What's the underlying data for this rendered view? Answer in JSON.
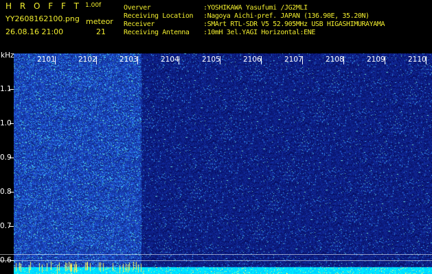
{
  "header": {
    "app_title": "H R O F F T",
    "version": "1.00f",
    "filename": "YY2608162100.png",
    "datetime": "26.08.16 21:00",
    "counter_label": "meteor",
    "counter_value": "21",
    "info": [
      {
        "label": "Overver",
        "value": ":YOSHIKAWA Yasufumi /JG2MLI"
      },
      {
        "label": "Receiving Location",
        "value": ":Nagoya Aichi-pref. JAPAN (136.90E, 35.20N)"
      },
      {
        "label": "Receiver",
        "value": ":SMArt RTL-SDR V5 52.905MHz USB HIGASHIMURAYAMA"
      },
      {
        "label": "Receiving Antenna",
        "value": ":10mH 3el.YAGI Horizontal:ENE"
      }
    ]
  },
  "axes": {
    "y_unit": "kHz",
    "x_ticks": [
      "2101",
      "2102",
      "2103",
      "2104",
      "2105",
      "2106",
      "2107",
      "2108",
      "2109",
      "2110"
    ],
    "y_ticks": [
      "1.1",
      "1.0",
      "0.9",
      "0.8",
      "0.7",
      "0.6"
    ]
  },
  "colors": {
    "header_text": "#f2ee2e",
    "background": "#000000",
    "waterfall_base": "#0a1a8a",
    "noise_band": "#00d8ff"
  }
}
